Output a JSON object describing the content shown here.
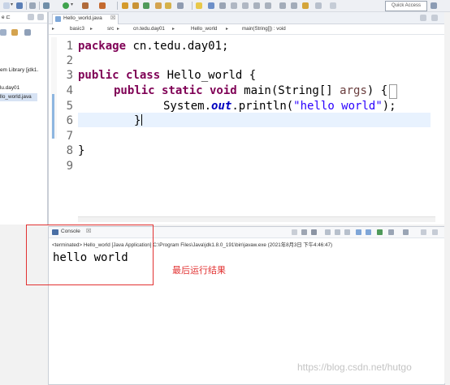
{
  "toolbar": {
    "quick_access": "Quick Access"
  },
  "left_panel": {
    "header": "e ⊏",
    "tree": [
      "em Library [jdk1.",
      "lu.day01",
      "llo_world.java"
    ]
  },
  "editor": {
    "tab_label": "Hello_world.java",
    "tab_close": "☒",
    "breadcrumb": [
      "basic3",
      "src",
      "cn.tedu.day01",
      "Hello_world",
      "main(String[]) : void"
    ],
    "line_numbers": [
      "1",
      "2",
      "3",
      "4",
      "5",
      "6",
      "7",
      "8",
      "9"
    ],
    "code": {
      "l1_kw": "package",
      "l1_rest": " cn.tedu.day01;",
      "l3_kw": "public class",
      "l3_rest": " Hello_world {",
      "l4_kw": "public static void",
      "l4_mid": " main(String[] ",
      "l4_param": "args",
      "l4_end": ") {",
      "l5_a": "System.",
      "l5_field": "out",
      "l5_b": ".println(",
      "l5_str": "\"hello world\"",
      "l5_end": ");",
      "l6": "}",
      "l8": "}"
    }
  },
  "console": {
    "tab_label": "Console",
    "tab_close": "☒",
    "status": "<terminated> Hello_world [Java Application] C:\\Program Files\\Java\\jdk1.8.0_191\\bin\\javaw.exe (2021年8月3日 下午4:46:47)",
    "output": "hello world"
  },
  "annotation": {
    "text": "最后运行结果",
    "color": "#e23232"
  },
  "watermark": "https://blog.csdn.net/hutgo",
  "colors": {
    "keyword": "#7f0055",
    "string": "#2a00ff",
    "field": "#0000c0",
    "current_line": "#e8f2fe"
  },
  "icons": [
    "console-icon",
    "java-file-icon",
    "run-icon",
    "debug-icon",
    "search-icon"
  ]
}
